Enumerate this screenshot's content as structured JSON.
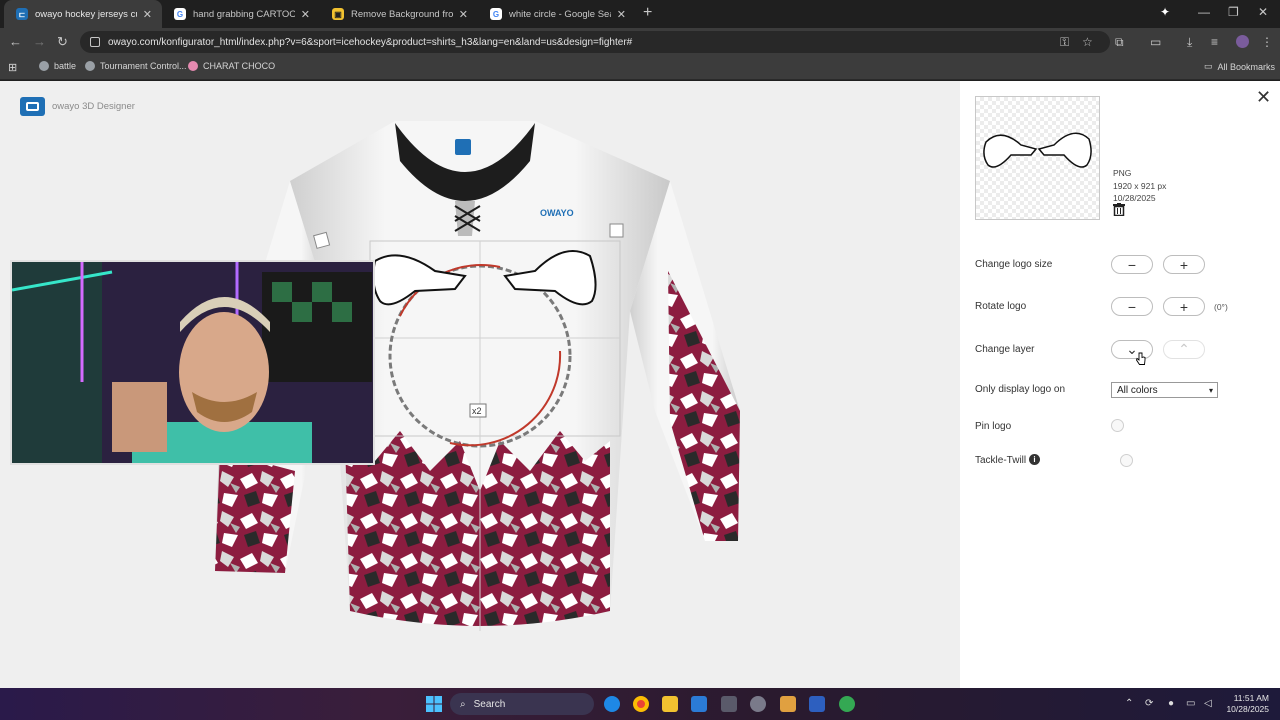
{
  "browser": {
    "tabs": [
      {
        "title": "owayo hockey jerseys custom d",
        "favicon": "owayo-icon",
        "color": "#1f6fb5"
      },
      {
        "title": "hand grabbing CARTOON - Go",
        "favicon": "google-icon",
        "color": "#4285f4"
      },
      {
        "title": "Remove Background from Imag",
        "favicon": "removebg-icon",
        "color": "#f2c230"
      },
      {
        "title": "white circle - Google Search",
        "favicon": "google-icon",
        "color": "#4285f4"
      }
    ],
    "url": "owayo.com/konfigurator_html/index.php?v=6&sport=icehockey&product=shirts_h3&lang=en&land=us&design=fighter#",
    "bookmarks": [
      {
        "label": "battle"
      },
      {
        "label": "Tournament Control..."
      },
      {
        "label": "CHARAT CHOCO"
      }
    ],
    "all_bookmarks": "All Bookmarks"
  },
  "designer": {
    "brand": "owayo 3D Designer",
    "jersey_brand": "OWAYO",
    "logo_scale_label": "x2"
  },
  "panel": {
    "file": {
      "type": "PNG",
      "dimensions": "1920 x 921 px",
      "date": "10/28/2025"
    },
    "rows": {
      "size_label": "Change logo size",
      "rotate_label": "Rotate logo",
      "rotate_value": "(0°)",
      "layer_label": "Change layer",
      "display_label": "Only display logo on",
      "display_value": "All colors",
      "pin_label": "Pin logo",
      "twill_label": "Tackle-Twill"
    },
    "buttons": {
      "minus": "−",
      "plus": "+",
      "down": "⌄",
      "up": "⌃"
    }
  },
  "taskbar": {
    "search_label": "Search",
    "time": "11:51 AM",
    "date": "10/28/2025"
  },
  "colors": {
    "jersey_primary": "#ffffff",
    "jersey_accent": "#8c1d40",
    "brand_blue": "#1f6fb5"
  }
}
